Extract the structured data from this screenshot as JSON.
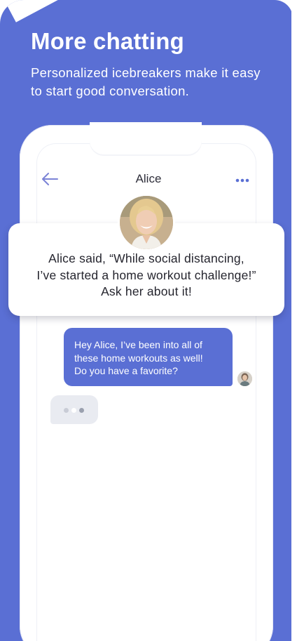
{
  "header": {
    "title": "More chatting",
    "subtitle": "Personalized icebreakers make it easy to start good conversation."
  },
  "chat": {
    "contact_name": "Alice",
    "back_icon": "arrow-left-icon",
    "menu_icon": "more-horizontal-icon",
    "prompt_lines": [
      "Alice said, “While social distancing,",
      "I’ve started a home workout challenge!”",
      "Ask her about it!"
    ],
    "message_lines": [
      "Hey Alice, I’ve been into all of",
      "these home workouts as well!",
      "Do you have a favorite?"
    ],
    "typing_indicator": "typing-dots-icon"
  },
  "colors": {
    "brand": "#5a6fd4",
    "bubble_out": "#5a6fd4",
    "bubble_in": "#e9ebf1",
    "text_dark": "#25252e",
    "icon_accent": "#7b83d6"
  }
}
